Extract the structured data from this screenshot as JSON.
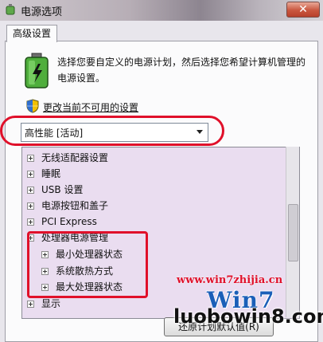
{
  "window": {
    "title": "电源选项",
    "close_glyph": "✕"
  },
  "tab": {
    "label": "高级设置"
  },
  "description": "选择您要自定义的电源计划，然后选择您希望计算机管理的电源设置。",
  "change_link": "更改当前不可用的设置",
  "plan_select": {
    "value": "高性能 [活动]"
  },
  "tree_items": [
    {
      "label": "无线适配器设置"
    },
    {
      "label": "睡眠"
    },
    {
      "label": "USB 设置"
    },
    {
      "label": "电源按钮和盖子"
    },
    {
      "label": "PCI Express"
    },
    {
      "label": "处理器电源管理"
    },
    {
      "label": "最小处理器状态"
    },
    {
      "label": "系统散热方式"
    },
    {
      "label": "最大处理器状态"
    },
    {
      "label": "显示"
    }
  ],
  "restore_button": "还原计划默认值(R)",
  "watermarks": {
    "url": "www.win7zhijia.cn",
    "win7": "Win7",
    "luobo": "luobowin8.com"
  },
  "icons": [
    "power-options-icon",
    "battery-icon",
    "shield-icon",
    "expand-icon",
    "dropdown-arrow-icon"
  ]
}
